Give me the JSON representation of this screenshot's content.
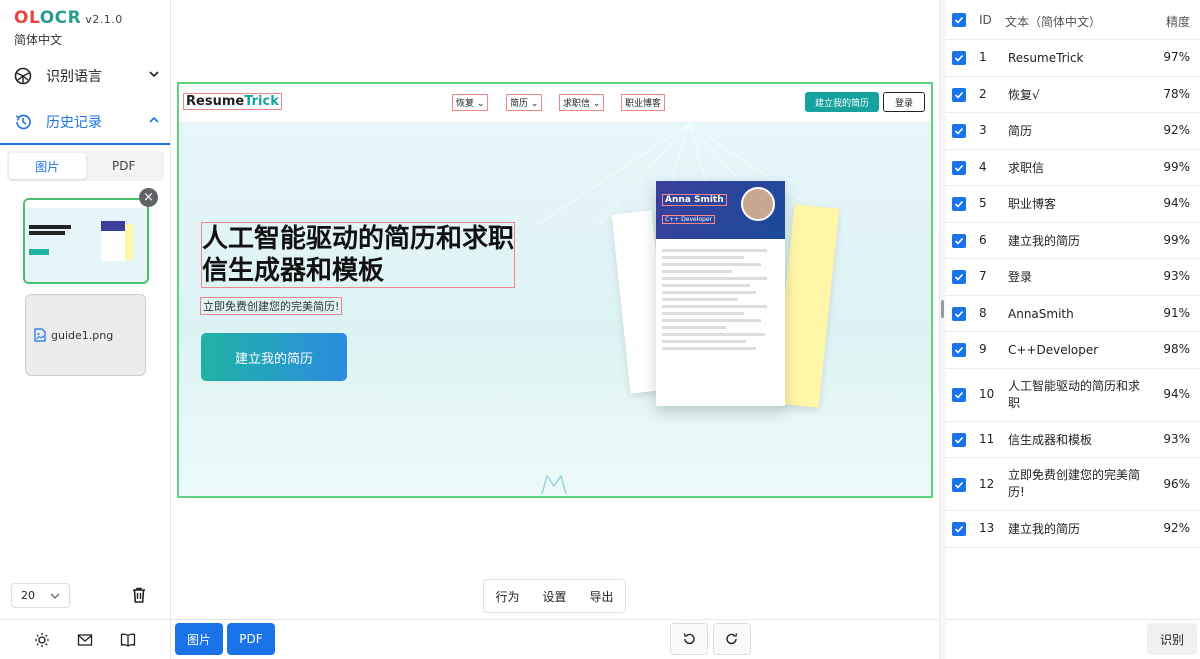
{
  "app": {
    "brand_a": "OL",
    "brand_b": "OCR",
    "version": "v2.1.0",
    "language": "简体中文"
  },
  "sidebar": {
    "lang_label": "识别语言",
    "history_label": "历史记录",
    "tabs": [
      "图片",
      "PDF"
    ],
    "file2_name": "guide1.png",
    "page_size": "20"
  },
  "site": {
    "logo_a": "Resume",
    "logo_b": "Trick",
    "nav": [
      "恢复",
      "简历",
      "求职信",
      "职业博客"
    ],
    "cta": "建立我的简历",
    "login": "登录",
    "hero_line1": "人工智能驱动的简历和求职",
    "hero_line2": "信生成器和模板",
    "hero_sub": "立即免费创建您的完美简历!",
    "hero_btn": "建立我的简历",
    "resume_name": "Anna Smith",
    "resume_role": "C++ Developer"
  },
  "toolbar": {
    "behavior": "行为",
    "settings": "设置",
    "export": "导出"
  },
  "bottom": {
    "image_btn": "图片",
    "pdf_btn": "PDF",
    "recognize_btn": "识别"
  },
  "results": {
    "header": {
      "id": "ID",
      "text": "文本（简体中文）",
      "acc": "精度"
    },
    "rows": [
      {
        "id": "1",
        "text": "ResumeTrick",
        "acc": "97%"
      },
      {
        "id": "2",
        "text": "恢复√",
        "acc": "78%"
      },
      {
        "id": "3",
        "text": "简历",
        "acc": "92%"
      },
      {
        "id": "4",
        "text": "求职信",
        "acc": "99%"
      },
      {
        "id": "5",
        "text": "职业博客",
        "acc": "94%"
      },
      {
        "id": "6",
        "text": "建立我的简历",
        "acc": "99%"
      },
      {
        "id": "7",
        "text": "登录",
        "acc": "93%"
      },
      {
        "id": "8",
        "text": "AnnaSmith",
        "acc": "91%"
      },
      {
        "id": "9",
        "text": "C++Developer",
        "acc": "98%"
      },
      {
        "id": "10",
        "text": "人工智能驱动的简历和求职",
        "acc": "94%"
      },
      {
        "id": "11",
        "text": "信生成器和模板",
        "acc": "93%"
      },
      {
        "id": "12",
        "text": "立即免费创建您的完美简历!",
        "acc": "96%"
      },
      {
        "id": "13",
        "text": "建立我的简历",
        "acc": "92%"
      }
    ]
  },
  "colors": {
    "accent": "#1a73e8",
    "selected": "#46c06f",
    "brand_red": "#e8453c",
    "brand_teal": "#2a9d8f"
  }
}
